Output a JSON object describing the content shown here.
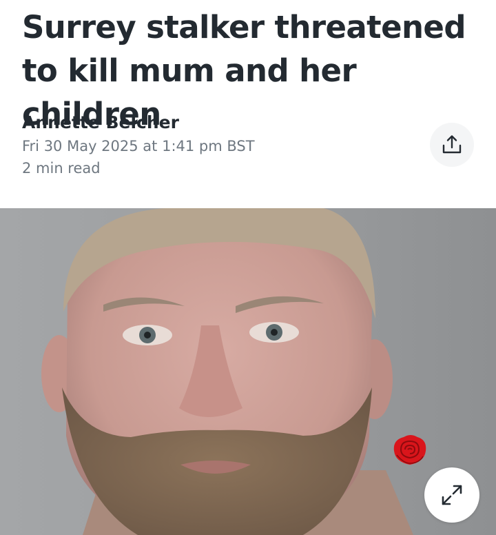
{
  "article": {
    "headline": "Surrey stalker threatened to kill mum and her children",
    "author": "Annette Belcher",
    "published": "Fri 30 May 2025 at 1:41 pm BST",
    "read_time": "2 min read"
  },
  "icons": {
    "share": "share-icon",
    "expand": "expand-icon",
    "sticker": "rose-icon"
  },
  "colors": {
    "text": "#232a31",
    "meta": "#6e7780",
    "button_bg": "#f4f5f6",
    "rose": "#d9151b"
  }
}
